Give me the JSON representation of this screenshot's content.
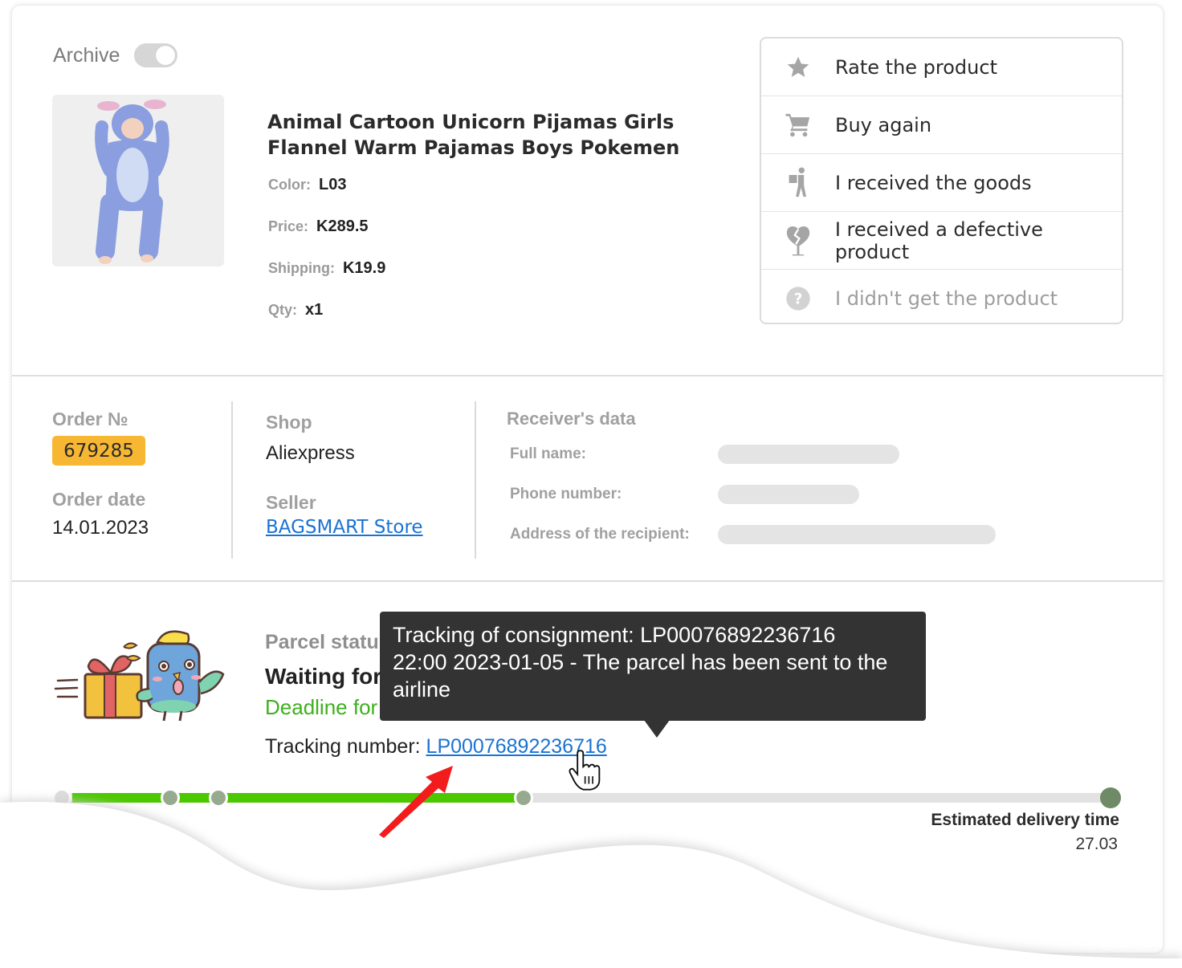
{
  "archive": {
    "label": "Archive",
    "enabled": false
  },
  "product": {
    "image_alt": "Child wearing blue Stitch-style animal pajamas",
    "title_line1": "Animal Cartoon Unicorn Pijamas Girls",
    "title_line2": "Flannel Warm Pajamas Boys Pokemen",
    "attributes": [
      {
        "label": "Color:",
        "value": "L03"
      },
      {
        "label": "Price:",
        "value": "K289.5"
      },
      {
        "label": "Shipping:",
        "value": "K19.9"
      },
      {
        "label": "Qty:",
        "value": "x1"
      }
    ]
  },
  "actions": [
    {
      "label": "Rate the product",
      "icon": "star-icon",
      "disabled": false
    },
    {
      "label": "Buy again",
      "icon": "cart-icon",
      "disabled": false
    },
    {
      "label": "I received the goods",
      "icon": "courier-icon",
      "disabled": false
    },
    {
      "label": "I received a defective product",
      "icon": "broken-heart-icon",
      "disabled": false
    },
    {
      "label": "I didn't get the product",
      "icon": "question-icon",
      "disabled": true
    }
  ],
  "order": {
    "number_label": "Order №",
    "number": "679285",
    "date_label": "Order date",
    "date": "14.01.2023",
    "shop_label": "Shop",
    "shop": "Aliexpress",
    "seller_label": "Seller",
    "seller": "BAGSMART Store"
  },
  "receiver": {
    "title": "Receiver's data",
    "fields": [
      {
        "label": "Full name:"
      },
      {
        "label": "Phone number:"
      },
      {
        "label": "Address of the recipient:"
      }
    ]
  },
  "parcel": {
    "status_label": "Parcel statu",
    "status": "Waiting for",
    "deadline": "Deadline for",
    "tracking_label": "Tracking number:",
    "tracking_number": "LP00076892236716"
  },
  "tooltip": {
    "line1": "Tracking of consignment: LP00076892236716",
    "line2": "22:00 2023-01-05 - The parcel has been sent to the",
    "line3": "airline"
  },
  "progress": {
    "completed_fraction": 0.44,
    "eta_label": "Estimated delivery time",
    "eta_value": "27.03"
  },
  "colors": {
    "order_badge": "#f7b733",
    "link": "#1a73d1",
    "progress_fill": "#4cc800",
    "deadline_text": "#3db01d",
    "tooltip_bg": "#333333"
  }
}
